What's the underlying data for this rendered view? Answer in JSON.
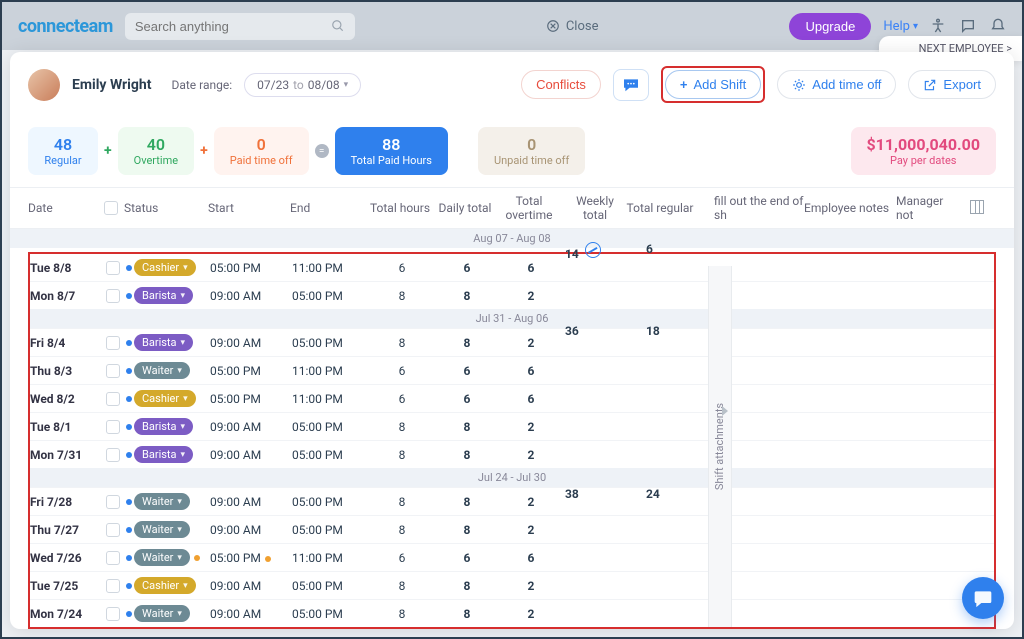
{
  "topbar": {
    "logo": "connecteam",
    "search_placeholder": "Search anything",
    "close": "Close",
    "upgrade": "Upgrade",
    "help": "Help",
    "next_employee": "NEXT EMPLOYEE >"
  },
  "header": {
    "employee_name": "Emily Wright",
    "date_range_label": "Date range:",
    "date_from": "07/23",
    "date_to_word": "to",
    "date_to": "08/08",
    "conflicts": "Conflicts",
    "add_shift": "Add Shift",
    "add_time_off": "Add time off",
    "export": "Export"
  },
  "stats": {
    "regular": {
      "value": "48",
      "label": "Regular"
    },
    "overtime": {
      "value": "40",
      "label": "Overtime"
    },
    "pto": {
      "value": "0",
      "label": "Paid time off"
    },
    "total_paid": {
      "value": "88",
      "label": "Total Paid Hours"
    },
    "unpaid": {
      "value": "0",
      "label": "Unpaid time off"
    },
    "pay": {
      "value": "$11,000,040.00",
      "label": "Pay per dates"
    }
  },
  "columns": {
    "date": "Date",
    "status": "Status",
    "start": "Start",
    "end": "End",
    "total_hours": "Total hours",
    "daily_total": "Daily total",
    "total_overtime": "Total overtime",
    "weekly_total": "Weekly total",
    "total_regular": "Total regular",
    "fill_out": "fill out the end of sh",
    "employee_notes": "Employee notes",
    "manager_notes": "Manager not"
  },
  "side_panel": "Shift attachments",
  "groups": [
    {
      "label": "Aug 07 - Aug 08",
      "weekly_total": "14",
      "total_regular": "6",
      "rows": [
        {
          "date": "Tue 8/8",
          "role": "Cashier",
          "role_class": "cashier",
          "start": "05:00 PM",
          "end": "11:00 PM",
          "total": "6",
          "daily": "6",
          "ot": "6"
        },
        {
          "date": "Mon 8/7",
          "role": "Barista",
          "role_class": "barista",
          "start": "09:00 AM",
          "end": "05:00 PM",
          "total": "8",
          "daily": "8",
          "ot": "2"
        }
      ]
    },
    {
      "label": "Jul 31 - Aug 06",
      "weekly_total": "36",
      "total_regular": "18",
      "rows": [
        {
          "date": "Fri 8/4",
          "role": "Barista",
          "role_class": "barista",
          "start": "09:00 AM",
          "end": "05:00 PM",
          "total": "8",
          "daily": "8",
          "ot": "2"
        },
        {
          "date": "Thu 8/3",
          "role": "Waiter",
          "role_class": "waiter",
          "start": "05:00 PM",
          "end": "11:00 PM",
          "total": "6",
          "daily": "6",
          "ot": "6"
        },
        {
          "date": "Wed 8/2",
          "role": "Cashier",
          "role_class": "cashier",
          "start": "05:00 PM",
          "end": "11:00 PM",
          "total": "6",
          "daily": "6",
          "ot": "6"
        },
        {
          "date": "Tue 8/1",
          "role": "Barista",
          "role_class": "barista",
          "start": "09:00 AM",
          "end": "05:00 PM",
          "total": "8",
          "daily": "8",
          "ot": "2"
        },
        {
          "date": "Mon 7/31",
          "role": "Barista",
          "role_class": "barista",
          "start": "09:00 AM",
          "end": "05:00 PM",
          "total": "8",
          "daily": "8",
          "ot": "2"
        }
      ]
    },
    {
      "label": "Jul 24 - Jul 30",
      "weekly_total": "38",
      "total_regular": "24",
      "rows": [
        {
          "date": "Fri 7/28",
          "role": "Waiter",
          "role_class": "waiter",
          "start": "09:00 AM",
          "end": "05:00 PM",
          "total": "8",
          "daily": "8",
          "ot": "2"
        },
        {
          "date": "Thu 7/27",
          "role": "Waiter",
          "role_class": "waiter",
          "start": "09:00 AM",
          "end": "05:00 PM",
          "total": "8",
          "daily": "8",
          "ot": "2"
        },
        {
          "date": "Wed 7/26",
          "role": "Waiter",
          "role_class": "waiter",
          "start": "05:00 PM",
          "end": "11:00 PM",
          "total": "6",
          "daily": "6",
          "ot": "6",
          "warn": true
        },
        {
          "date": "Tue 7/25",
          "role": "Cashier",
          "role_class": "cashier",
          "start": "09:00 AM",
          "end": "05:00 PM",
          "total": "8",
          "daily": "8",
          "ot": "2"
        },
        {
          "date": "Mon 7/24",
          "role": "Waiter",
          "role_class": "waiter",
          "start": "09:00 AM",
          "end": "05:00 PM",
          "total": "8",
          "daily": "8",
          "ot": "2"
        }
      ]
    }
  ]
}
